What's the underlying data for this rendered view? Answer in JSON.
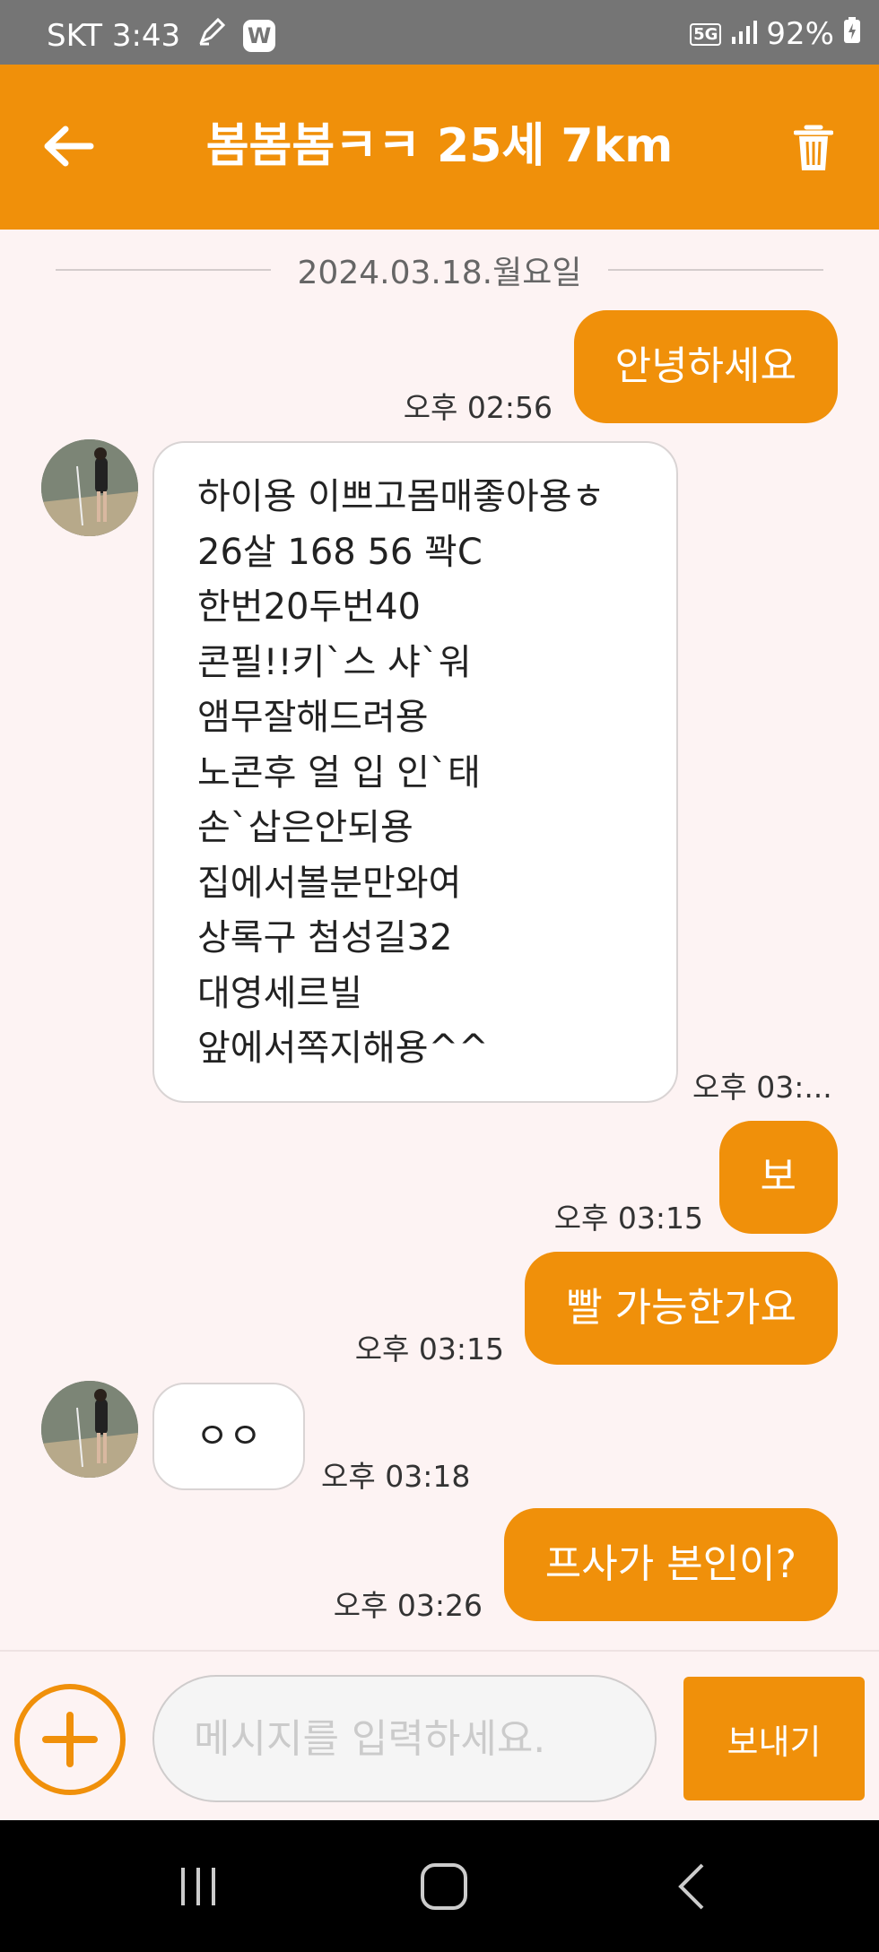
{
  "status_bar": {
    "carrier_time": "SKT 3:43",
    "app_badge": "W",
    "network": "5G",
    "battery": "92%"
  },
  "header": {
    "title": "봄봄봄ㅋㅋ 25세 7km",
    "back_icon": "arrow-left-icon",
    "trash_icon": "trash-icon"
  },
  "chat": {
    "date": "2024.03.18.월요일",
    "messages": [
      {
        "side": "out",
        "text": "안녕하세요",
        "time": "오후 02:56"
      },
      {
        "side": "in",
        "lines": [
          "하이용 이쁘고몸매좋아용ㅎ",
          "26살 168 56 꽉C",
          "한번20두번40",
          "콘필!!키`스 샤`워",
          "앰무잘해드려용",
          "노콘후 얼 입 인`태",
          "손`삽은안되용",
          "집에서볼분만와여",
          "상록구 첨성길32",
          "대영세르빌",
          "앞에서쪽지해용^^"
        ],
        "time": "오후 03:..."
      },
      {
        "side": "out",
        "text": "보",
        "time": "오후 03:15"
      },
      {
        "side": "out",
        "text": "빨 가능한가요",
        "time": "오후 03:15"
      },
      {
        "side": "in",
        "text": "ㅇㅇ",
        "time": "오후 03:18"
      },
      {
        "side": "out",
        "text": "프사가 본인이?",
        "time": "오후 03:26"
      }
    ]
  },
  "input_bar": {
    "placeholder": "메시지를 입력하세요.",
    "value": "",
    "send_label": "보내기",
    "add_icon": "plus-circle-icon"
  },
  "nav_bar": {
    "icons": [
      "recent-apps-icon",
      "home-icon",
      "back-icon"
    ]
  },
  "colors": {
    "accent": "#f0900a",
    "background": "#fdf3f3",
    "status_bar": "#757575",
    "nav_bar": "#000000"
  }
}
